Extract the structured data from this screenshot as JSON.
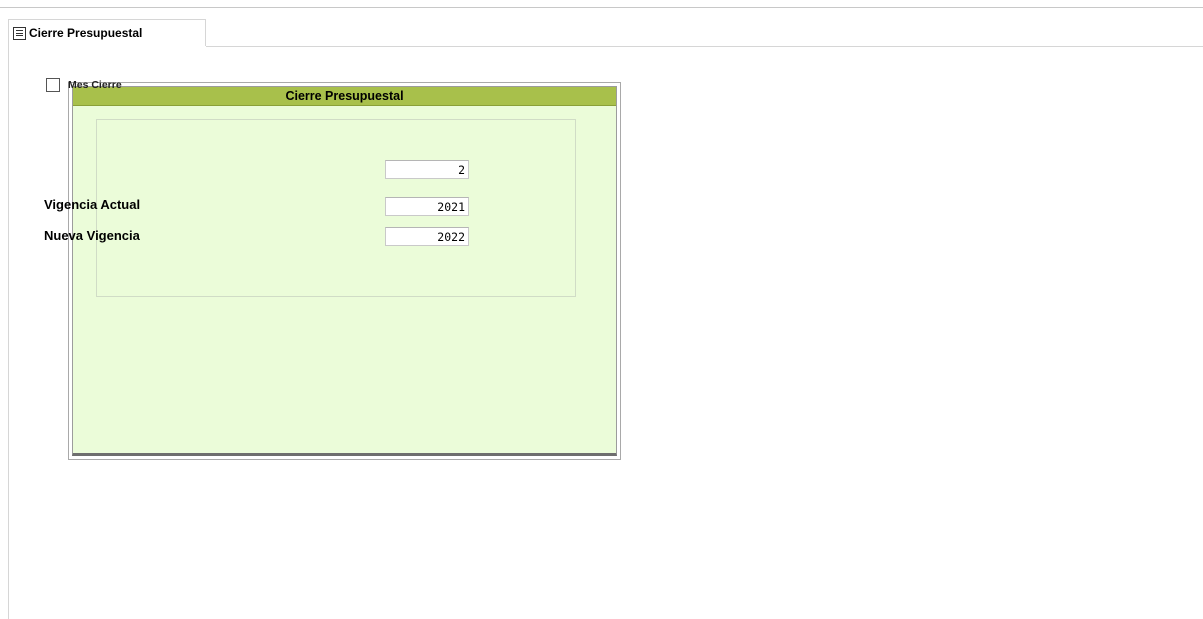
{
  "tab": {
    "icon": "form-list-icon",
    "label": "Cierre Presupuestal"
  },
  "panel": {
    "title": "Cierre Presupuestal",
    "colors": {
      "header": "#a8c04b",
      "body": "#ebfcd9"
    },
    "fields": {
      "mes_cierre": {
        "label": "Mes Cierre",
        "checked": false,
        "value": "2"
      },
      "vigencia_actual": {
        "label": "Vigencia Actual",
        "value": "2021"
      },
      "nueva_vigencia": {
        "label": "Nueva Vigencia",
        "value": "2022"
      }
    }
  }
}
